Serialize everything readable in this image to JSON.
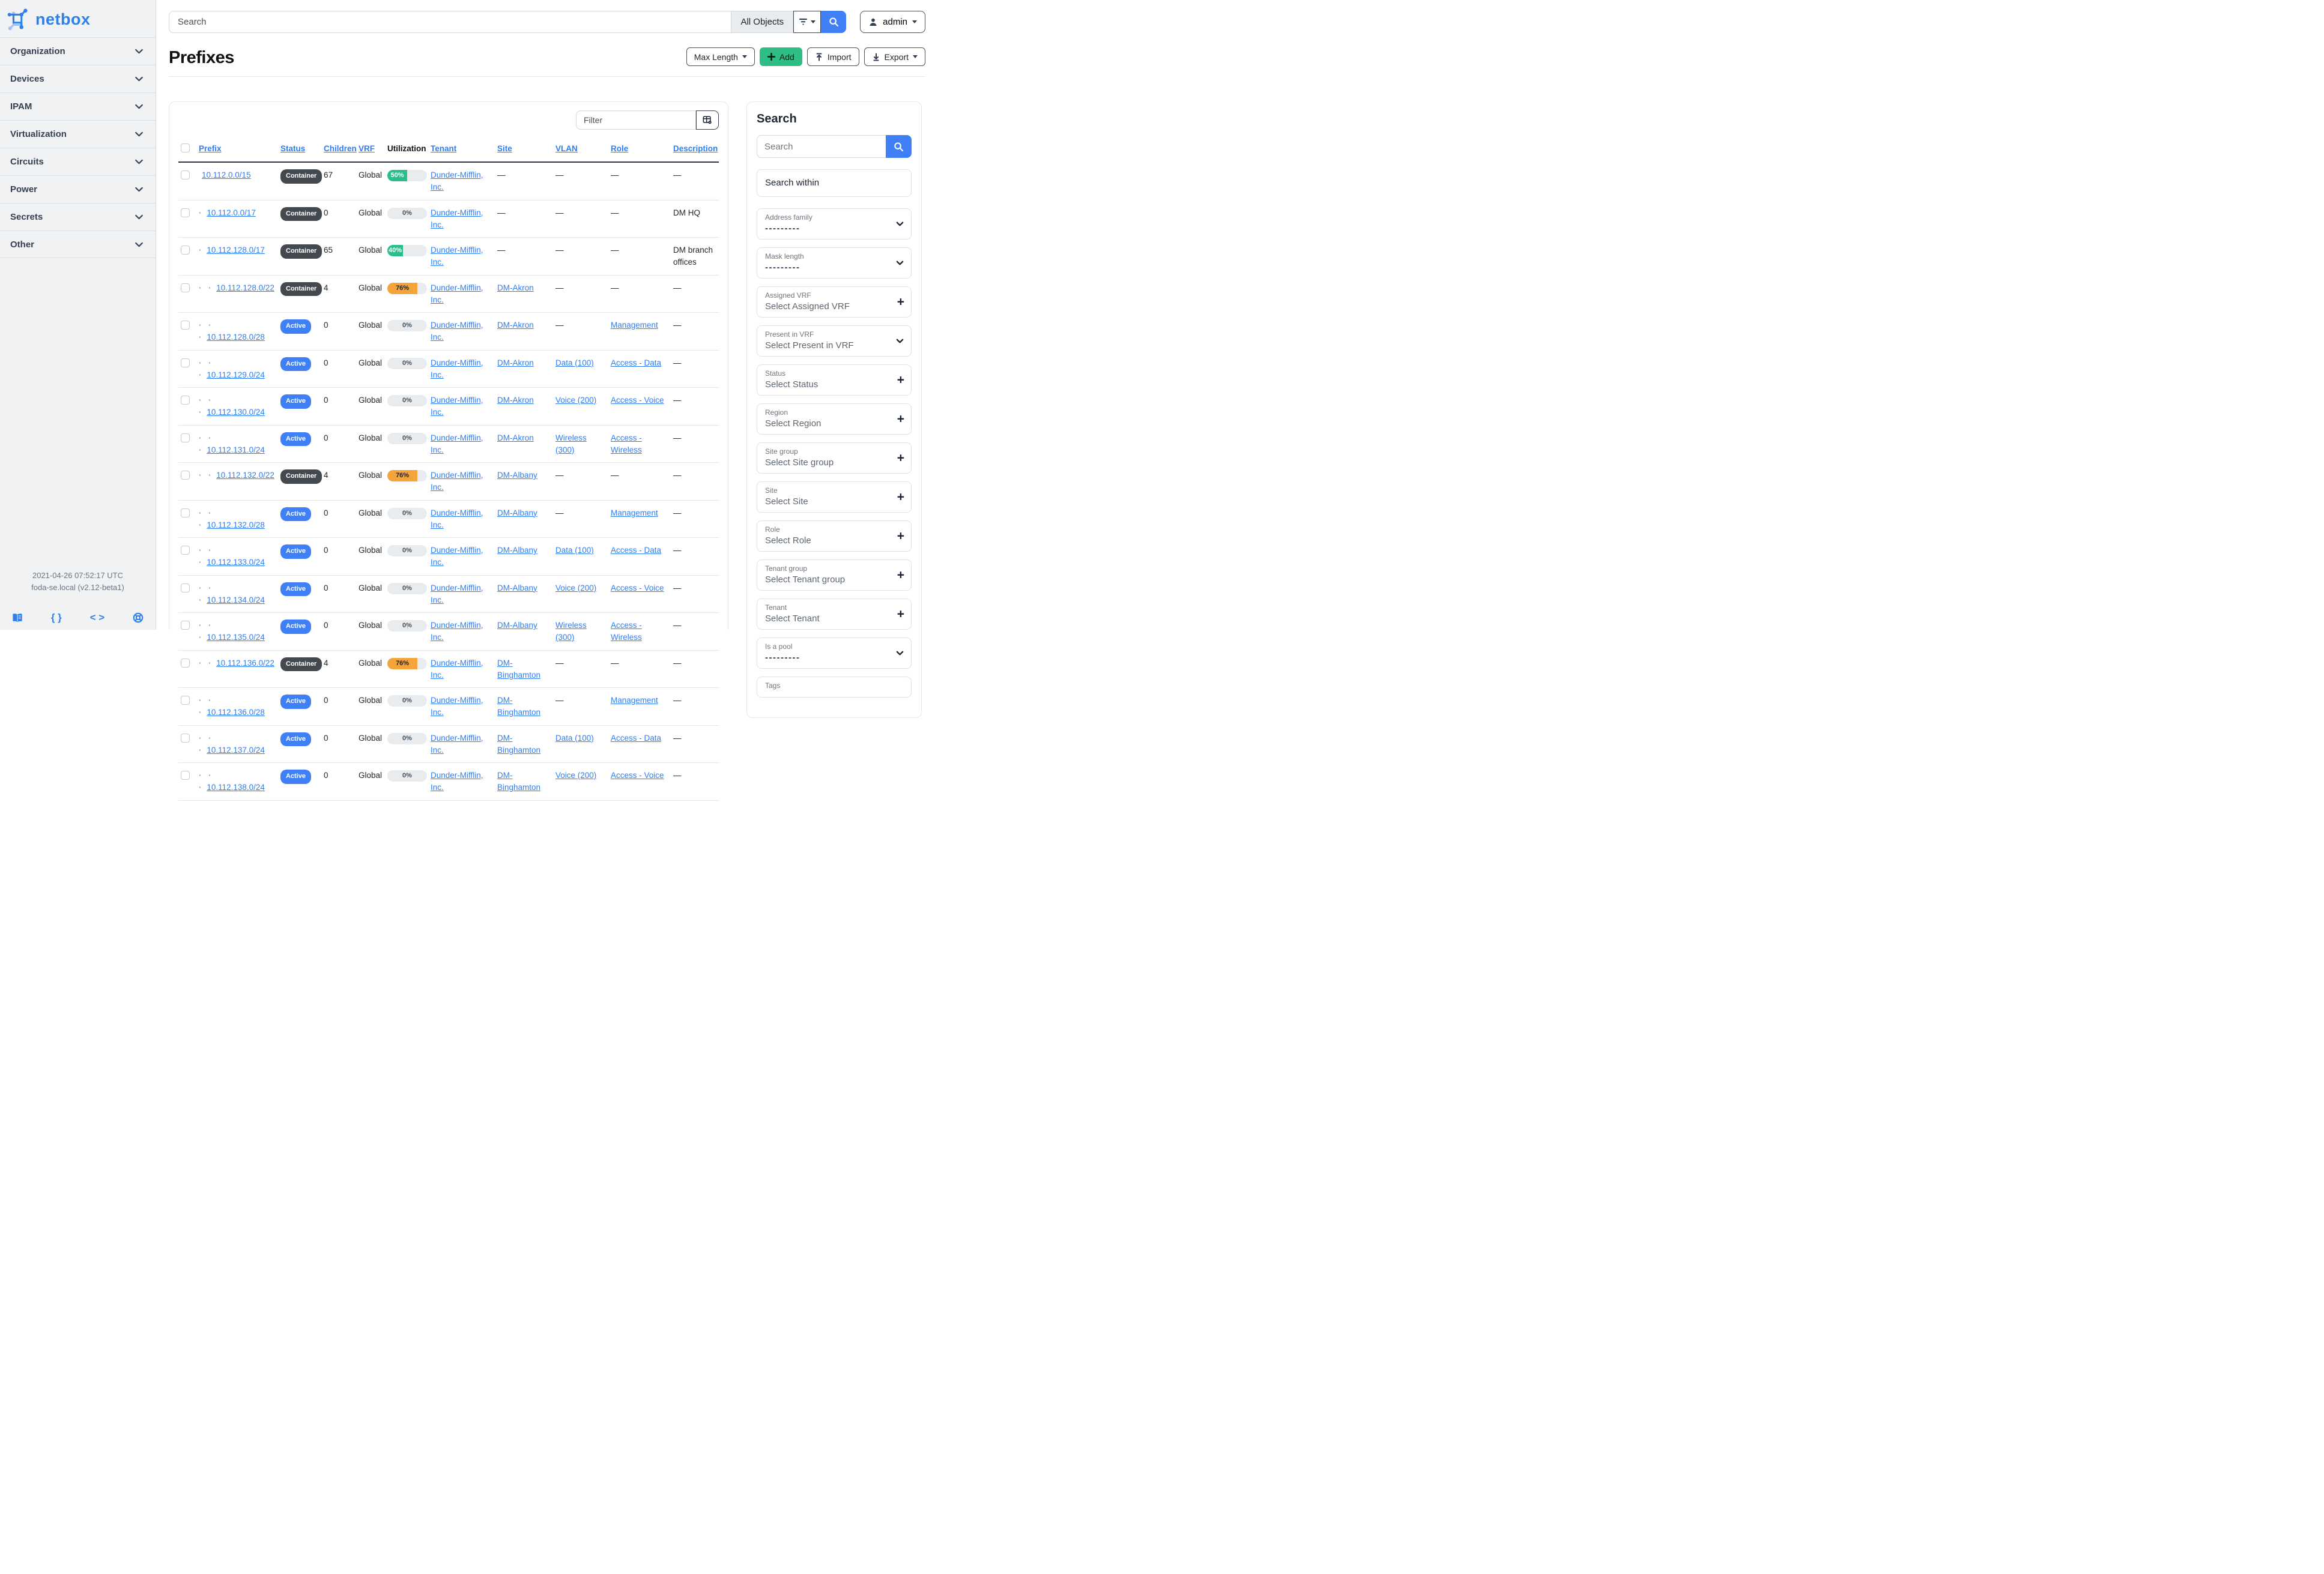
{
  "brand": {
    "name": "netbox",
    "color": "#2f80ed"
  },
  "topbar": {
    "search_placeholder": "Search",
    "scope_label": "All Objects",
    "user_label": "admin"
  },
  "sidebar": {
    "items": [
      "Organization",
      "Devices",
      "IPAM",
      "Virtualization",
      "Circuits",
      "Power",
      "Secrets",
      "Other"
    ],
    "footer": {
      "timestamp": "2021-04-26 07:52:17 UTC",
      "host": "foda-se.local (v2.12-beta1)",
      "icons": [
        "docs-book-icon",
        "rest-api-braces-icon",
        "code-icon",
        "support-lifering-icon"
      ]
    }
  },
  "page": {
    "title": "Prefixes",
    "buttons": {
      "max_length": "Max Length",
      "add": "Add",
      "import": "Import",
      "export": "Export"
    }
  },
  "table": {
    "filter_placeholder": "Filter",
    "empty": "—",
    "columns": [
      {
        "label": "Prefix",
        "sortable": true
      },
      {
        "label": "Status",
        "sortable": true
      },
      {
        "label": "Children",
        "sortable": true
      },
      {
        "label": "VRF",
        "sortable": true
      },
      {
        "label": "Utilization",
        "sortable": false
      },
      {
        "label": "Tenant",
        "sortable": true
      },
      {
        "label": "Site",
        "sortable": true
      },
      {
        "label": "VLAN",
        "sortable": true
      },
      {
        "label": "Role",
        "sortable": true
      },
      {
        "label": "Description",
        "sortable": true
      }
    ],
    "rows": [
      {
        "prefix": "10.112.0.0/15",
        "depth": 0,
        "status": "Container",
        "children": "67",
        "vrf": "Global",
        "util": 50,
        "util_color": "green",
        "tenant": "Dunder-Mifflin, Inc.",
        "site": "",
        "vlan": "",
        "role": "",
        "description": ""
      },
      {
        "prefix": "10.112.0.0/17",
        "depth": 1,
        "status": "Container",
        "children": "0",
        "vrf": "Global",
        "util": 0,
        "util_color": "zero",
        "tenant": "Dunder-Mifflin, Inc.",
        "site": "",
        "vlan": "",
        "role": "",
        "description": "DM HQ"
      },
      {
        "prefix": "10.112.128.0/17",
        "depth": 1,
        "status": "Container",
        "children": "65",
        "vrf": "Global",
        "util": 40,
        "util_color": "green",
        "tenant": "Dunder-Mifflin, Inc.",
        "site": "",
        "vlan": "",
        "role": "",
        "description": "DM branch offices"
      },
      {
        "prefix": "10.112.128.0/22",
        "depth": 2,
        "status": "Container",
        "children": "4",
        "vrf": "Global",
        "util": 76,
        "util_color": "orange",
        "tenant": "Dunder-Mifflin, Inc.",
        "site": "DM-Akron",
        "vlan": "",
        "role": "",
        "description": ""
      },
      {
        "prefix": "10.112.128.0/28",
        "depth": 3,
        "status": "Active",
        "children": "0",
        "vrf": "Global",
        "util": 0,
        "util_color": "zero",
        "tenant": "Dunder-Mifflin, Inc.",
        "site": "DM-Akron",
        "vlan": "",
        "role": "Management",
        "description": ""
      },
      {
        "prefix": "10.112.129.0/24",
        "depth": 3,
        "status": "Active",
        "children": "0",
        "vrf": "Global",
        "util": 0,
        "util_color": "zero",
        "tenant": "Dunder-Mifflin, Inc.",
        "site": "DM-Akron",
        "vlan": "Data (100)",
        "role": "Access - Data",
        "description": ""
      },
      {
        "prefix": "10.112.130.0/24",
        "depth": 3,
        "status": "Active",
        "children": "0",
        "vrf": "Global",
        "util": 0,
        "util_color": "zero",
        "tenant": "Dunder-Mifflin, Inc.",
        "site": "DM-Akron",
        "vlan": "Voice (200)",
        "role": "Access - Voice",
        "description": ""
      },
      {
        "prefix": "10.112.131.0/24",
        "depth": 3,
        "status": "Active",
        "children": "0",
        "vrf": "Global",
        "util": 0,
        "util_color": "zero",
        "tenant": "Dunder-Mifflin, Inc.",
        "site": "DM-Akron",
        "vlan": "Wireless (300)",
        "role": "Access - Wireless",
        "description": ""
      },
      {
        "prefix": "10.112.132.0/22",
        "depth": 2,
        "status": "Container",
        "children": "4",
        "vrf": "Global",
        "util": 76,
        "util_color": "orange",
        "tenant": "Dunder-Mifflin, Inc.",
        "site": "DM-Albany",
        "vlan": "",
        "role": "",
        "description": ""
      },
      {
        "prefix": "10.112.132.0/28",
        "depth": 3,
        "status": "Active",
        "children": "0",
        "vrf": "Global",
        "util": 0,
        "util_color": "zero",
        "tenant": "Dunder-Mifflin, Inc.",
        "site": "DM-Albany",
        "vlan": "",
        "role": "Management",
        "description": ""
      },
      {
        "prefix": "10.112.133.0/24",
        "depth": 3,
        "status": "Active",
        "children": "0",
        "vrf": "Global",
        "util": 0,
        "util_color": "zero",
        "tenant": "Dunder-Mifflin, Inc.",
        "site": "DM-Albany",
        "vlan": "Data (100)",
        "role": "Access - Data",
        "description": ""
      },
      {
        "prefix": "10.112.134.0/24",
        "depth": 3,
        "status": "Active",
        "children": "0",
        "vrf": "Global",
        "util": 0,
        "util_color": "zero",
        "tenant": "Dunder-Mifflin, Inc.",
        "site": "DM-Albany",
        "vlan": "Voice (200)",
        "role": "Access - Voice",
        "description": ""
      },
      {
        "prefix": "10.112.135.0/24",
        "depth": 3,
        "status": "Active",
        "children": "0",
        "vrf": "Global",
        "util": 0,
        "util_color": "zero",
        "tenant": "Dunder-Mifflin, Inc.",
        "site": "DM-Albany",
        "vlan": "Wireless (300)",
        "role": "Access - Wireless",
        "description": ""
      },
      {
        "prefix": "10.112.136.0/22",
        "depth": 2,
        "status": "Container",
        "children": "4",
        "vrf": "Global",
        "util": 76,
        "util_color": "orange",
        "tenant": "Dunder-Mifflin, Inc.",
        "site": "DM-Binghamton",
        "vlan": "",
        "role": "",
        "description": ""
      },
      {
        "prefix": "10.112.136.0/28",
        "depth": 3,
        "status": "Active",
        "children": "0",
        "vrf": "Global",
        "util": 0,
        "util_color": "zero",
        "tenant": "Dunder-Mifflin, Inc.",
        "site": "DM-Binghamton",
        "vlan": "",
        "role": "Management",
        "description": ""
      },
      {
        "prefix": "10.112.137.0/24",
        "depth": 3,
        "status": "Active",
        "children": "0",
        "vrf": "Global",
        "util": 0,
        "util_color": "zero",
        "tenant": "Dunder-Mifflin, Inc.",
        "site": "DM-Binghamton",
        "vlan": "Data (100)",
        "role": "Access - Data",
        "description": ""
      },
      {
        "prefix": "10.112.138.0/24",
        "depth": 3,
        "status": "Active",
        "children": "0",
        "vrf": "Global",
        "util": 0,
        "util_color": "zero",
        "tenant": "Dunder-Mifflin, Inc.",
        "site": "DM-Binghamton",
        "vlan": "Voice (200)",
        "role": "Access - Voice",
        "description": ""
      }
    ]
  },
  "filters_panel": {
    "title": "Search",
    "search_placeholder": "Search",
    "search_within_label": "Search within",
    "fields": [
      {
        "label": "Address family",
        "value": "---------",
        "dashes": true,
        "icon": "chevron"
      },
      {
        "label": "Mask length",
        "value": "---------",
        "dashes": true,
        "icon": "chevron"
      },
      {
        "label": "Assigned VRF",
        "value": "Select Assigned VRF",
        "dashes": false,
        "icon": "plus"
      },
      {
        "label": "Present in VRF",
        "value": "Select Present in VRF",
        "dashes": false,
        "icon": "chevron"
      },
      {
        "label": "Status",
        "value": "Select Status",
        "dashes": false,
        "icon": "plus"
      },
      {
        "label": "Region",
        "value": "Select Region",
        "dashes": false,
        "icon": "plus"
      },
      {
        "label": "Site group",
        "value": "Select Site group",
        "dashes": false,
        "icon": "plus"
      },
      {
        "label": "Site",
        "value": "Select Site",
        "dashes": false,
        "icon": "plus"
      },
      {
        "label": "Role",
        "value": "Select Role",
        "dashes": false,
        "icon": "plus"
      },
      {
        "label": "Tenant group",
        "value": "Select Tenant group",
        "dashes": false,
        "icon": "plus"
      },
      {
        "label": "Tenant",
        "value": "Select Tenant",
        "dashes": false,
        "icon": "plus"
      },
      {
        "label": "Is a pool",
        "value": "---------",
        "dashes": true,
        "icon": "chevron"
      },
      {
        "label": "Tags",
        "value": "",
        "dashes": false,
        "icon": "none"
      }
    ]
  },
  "colors": {
    "accent_blue": "#3f80f6",
    "link_blue": "#2e7ef5",
    "brand_blue": "#2f80ed",
    "green": "#2abf8a",
    "orange": "#f5a43b",
    "badge_dark": "#43494f",
    "add_green": "#2ebd85",
    "sidebar_bg": "#f1f2f4"
  }
}
